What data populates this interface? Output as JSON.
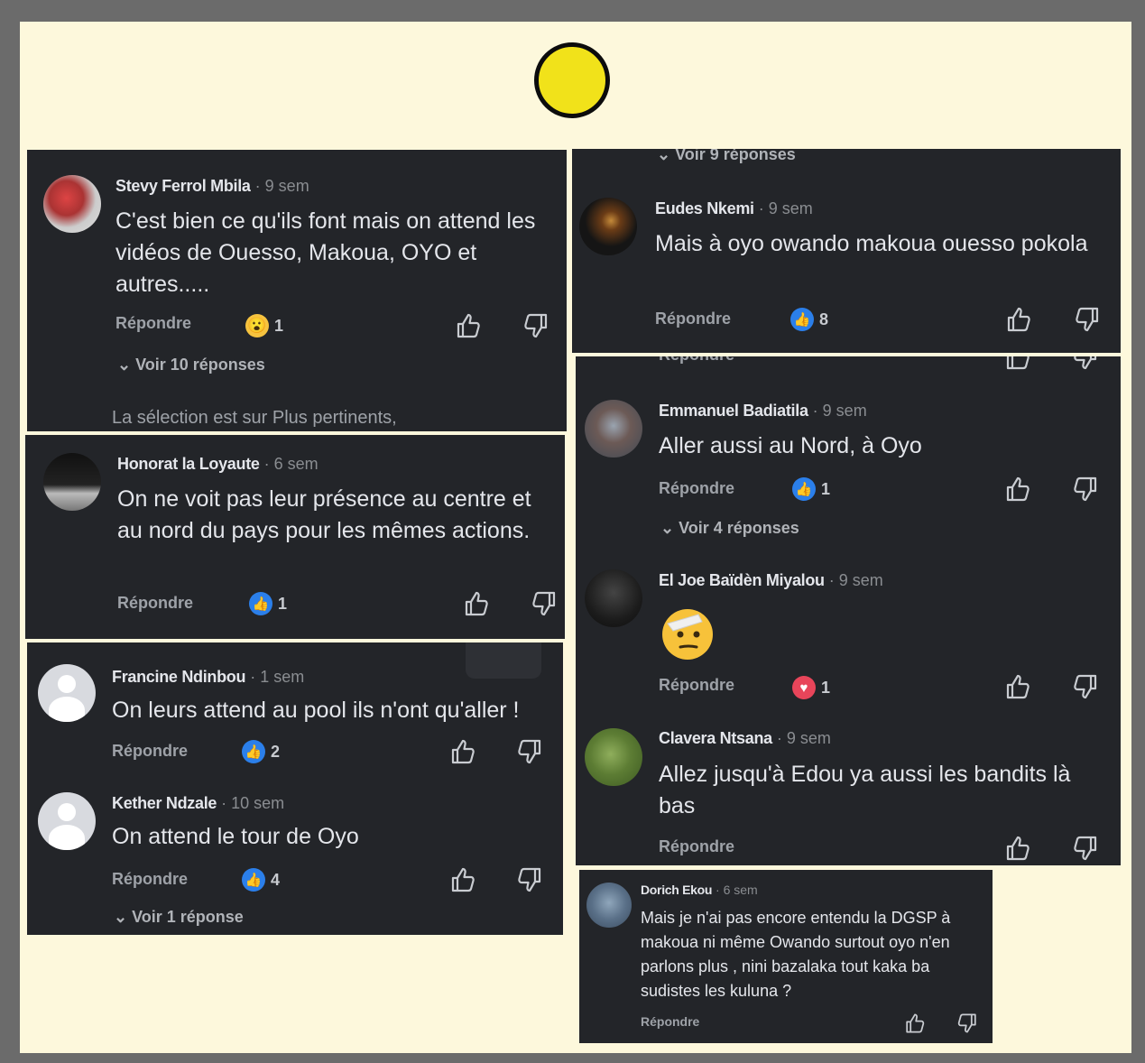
{
  "comments": {
    "stevy": {
      "name": "Stevy Ferrol Mbila",
      "time": "· 9 sem",
      "text": "C'est bien ce qu'ils font mais on attend les vidéos de Ouesso, Makoua, OYO et autres.....",
      "reply": "Répondre",
      "reaction": "wow",
      "count": "1",
      "replies": "Voir 10 réponses"
    },
    "selection_note": "La sélection est sur Plus pertinents,",
    "honorat": {
      "name": "Honorat la Loyaute",
      "time": "· 6 sem",
      "text": "On ne voit pas leur présence au centre et au nord du pays pour les mêmes actions.",
      "reply": "Répondre",
      "reaction": "like",
      "count": "1"
    },
    "francine": {
      "name": "Francine Ndinbou",
      "time": "· 1 sem",
      "text": "On leurs attend au pool ils n'ont qu'aller !",
      "reply": "Répondre",
      "reaction": "like",
      "count": "2"
    },
    "kether": {
      "name": "Kether Ndzale",
      "time": "· 10 sem",
      "text": "On attend le tour de Oyo",
      "reply": "Répondre",
      "reaction": "like",
      "count": "4",
      "replies": "Voir 1 réponse"
    },
    "top_right_replies": "Voir 9 réponses",
    "eudes": {
      "name": "Eudes Nkemi",
      "time": "· 9 sem",
      "text": "Mais à oyo owando makoua ouesso pokola",
      "reply": "Répondre",
      "reaction": "like",
      "count": "8"
    },
    "cut_reply": "Répondre",
    "emmanuel": {
      "name": "Emmanuel Badiatila",
      "time": "· 9 sem",
      "text": "Aller aussi au Nord, à Oyo",
      "reply": "Répondre",
      "reaction": "like",
      "count": "1",
      "replies": "Voir 4 réponses"
    },
    "eljoe": {
      "name": "El Joe Baïdèn Miyalou",
      "time": "· 9 sem",
      "reply": "Répondre",
      "reaction": "heart",
      "count": "1",
      "emoji": "saluting-face"
    },
    "clavera": {
      "name": "Clavera Ntsana",
      "time": "· 9 sem",
      "text": "Allez jusqu'à Edou ya aussi les bandits là bas",
      "reply": "Répondre"
    },
    "dorich": {
      "name": "Dorich Ekou",
      "time": "· 6 sem",
      "text": "Mais je n'ai pas encore entendu la DGSP à makoua ni même Owando surtout oyo n'en parlons plus , nini bazalaka tout kaka ba sudistes les kuluna ?",
      "reply": "Répondre"
    }
  },
  "colors": {
    "panel": "#232529",
    "frame": "#6b6b6b",
    "background": "#fdf8dc",
    "dot": "#f1e21a",
    "like": "#2b7fea",
    "heart": "#e8455a"
  }
}
